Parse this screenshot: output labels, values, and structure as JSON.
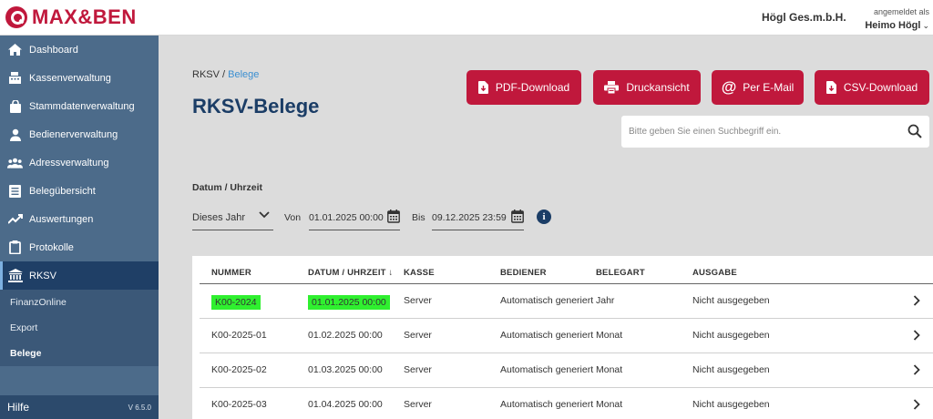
{
  "app": {
    "logo_text": "MAX&BEN",
    "company": "Högl Ges.m.b.H.",
    "user_label": "angemeldet als",
    "user_name": "Heimo Högl",
    "user_chevron": "⌄"
  },
  "sidebar": {
    "items": [
      {
        "label": "Dashboard",
        "icon": "home-icon"
      },
      {
        "label": "Kassenverwaltung",
        "icon": "register-icon"
      },
      {
        "label": "Stammdatenverwaltung",
        "icon": "bag-icon"
      },
      {
        "label": "Bedienerverwaltung",
        "icon": "user-icon"
      },
      {
        "label": "Adressverwaltung",
        "icon": "group-icon"
      },
      {
        "label": "Belegübersicht",
        "icon": "document-icon"
      },
      {
        "label": "Auswertungen",
        "icon": "trend-icon"
      },
      {
        "label": "Protokolle",
        "icon": "clipboard-icon"
      },
      {
        "label": "RKSV",
        "icon": "bank-icon",
        "active": true
      }
    ],
    "sub_items": [
      {
        "label": "FinanzOnline"
      },
      {
        "label": "Export"
      },
      {
        "label": "Belege",
        "active": true
      }
    ],
    "help": "Hilfe",
    "version": "V 6.5.0"
  },
  "main": {
    "breadcrumb_root": "RKSV",
    "breadcrumb_sep": " / ",
    "breadcrumb_current": "Belege",
    "title": "RKSV-Belege",
    "buttons": {
      "pdf": "PDF-Download",
      "print": "Druckansicht",
      "email": "Per E-Mail",
      "csv": "CSV-Download"
    },
    "search_placeholder": "Bitte geben Sie einen Suchbegriff ein.",
    "filter": {
      "label": "Datum / Uhrzeit",
      "period": "Dieses Jahr",
      "from_label": "Von",
      "from_value": "01.01.2025 00:00",
      "to_label": "Bis",
      "to_value": "09.12.2025 23:59",
      "info": "i"
    }
  },
  "table": {
    "columns": [
      "NUMMER",
      "DATUM / UHRZEIT ↓",
      "KASSE",
      "BEDIENER",
      "BELEGART",
      "AUSGABE"
    ],
    "rows": [
      {
        "nummer": "K00-2024",
        "datum": "01.01.2025 00:00",
        "kasse": "Server",
        "bediener": "Automatisch generiert",
        "belegart": "Jahr",
        "ausgabe": "Nicht ausgegeben",
        "highlighted": true
      },
      {
        "nummer": "K00-2025-01",
        "datum": "01.02.2025 00:00",
        "kasse": "Server",
        "bediener": "Automatisch generiert",
        "belegart": "Monat",
        "ausgabe": "Nicht ausgegeben"
      },
      {
        "nummer": "K00-2025-02",
        "datum": "01.03.2025 00:00",
        "kasse": "Server",
        "bediener": "Automatisch generiert",
        "belegart": "Monat",
        "ausgabe": "Nicht ausgegeben"
      },
      {
        "nummer": "K00-2025-03",
        "datum": "01.04.2025 00:00",
        "kasse": "Server",
        "bediener": "Automatisch generiert",
        "belegart": "Monat",
        "ausgabe": "Nicht ausgegeben"
      }
    ]
  },
  "colors": {
    "brand": "#c0183c",
    "sidebar": "#4c6b8a",
    "sidebar_active": "#1f3f66",
    "title": "#1b3d66",
    "highlight": "#2ff02f"
  }
}
